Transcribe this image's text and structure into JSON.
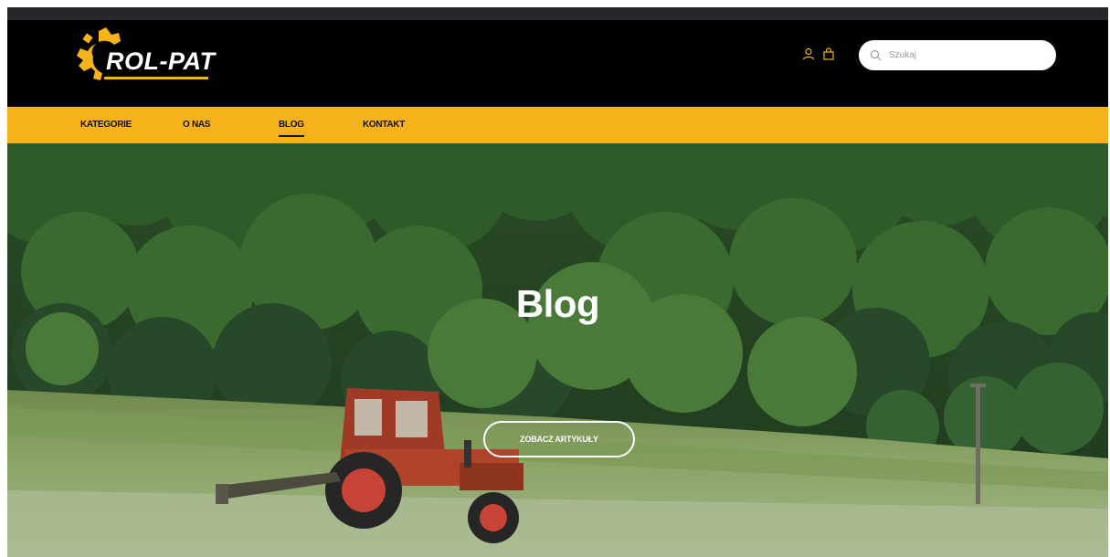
{
  "brand": {
    "name": "ROL-PAT",
    "accent_color": "#f6b21b",
    "header_bg": "#000000"
  },
  "header": {
    "icons": [
      "user-icon",
      "bag-icon",
      "search-icon"
    ],
    "search": {
      "placeholder": "Szukaj",
      "value": ""
    }
  },
  "nav": {
    "items": [
      {
        "label": "KATEGORIE",
        "active": false
      },
      {
        "label": "O NAS",
        "active": false
      },
      {
        "label": "BLOG",
        "active": true
      },
      {
        "label": "KONTAKT",
        "active": false
      }
    ]
  },
  "hero": {
    "title": "Blog",
    "button_label": "ZOBACZ ARTYKUŁY"
  }
}
